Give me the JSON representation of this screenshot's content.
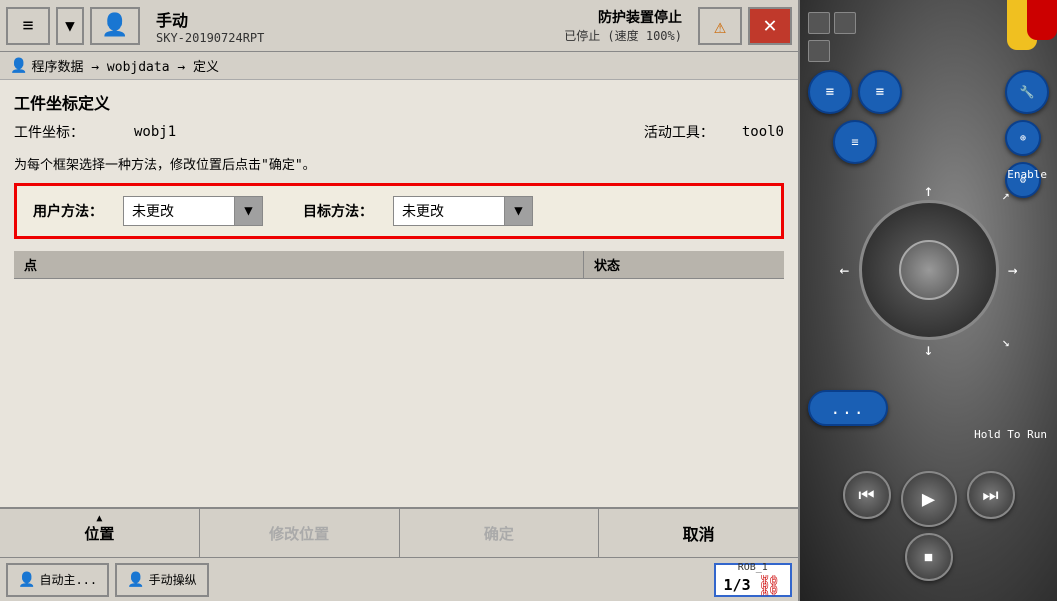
{
  "header": {
    "menu_label": "≡",
    "mode": "手动",
    "device_id": "SKY-20190724RPT",
    "protection_status": "防护装置停止",
    "speed_status": "已停止 (速度 100%)",
    "close_label": "✕"
  },
  "breadcrumb": {
    "path": "程序数据 → wobjdata → 定义"
  },
  "content": {
    "title": "工件坐标定义",
    "wobj_label": "工件坐标：",
    "wobj_value": "wobj1",
    "tool_label": "活动工具：",
    "tool_value": "tool0",
    "hint": "为每个框架选择一种方法，修改位置后点击\"确定\"。",
    "user_method_label": "用户方法：",
    "user_method_value": "未更改",
    "target_method_label": "目标方法：",
    "target_method_value": "未更改",
    "table": {
      "col1": "点",
      "col2": "状态"
    }
  },
  "bottom_bar": {
    "btn1": "位置",
    "btn2": "修改位置",
    "btn3": "确定",
    "btn4": "取消"
  },
  "status_bar": {
    "auto_btn": "自动主...",
    "manual_btn": "手动操纵",
    "rob_fraction": "1/3",
    "rob_label": "ROB_1"
  },
  "controller": {
    "enable_label": "Enable",
    "hold_label": "Hold To Run",
    "dots_label": "..."
  }
}
